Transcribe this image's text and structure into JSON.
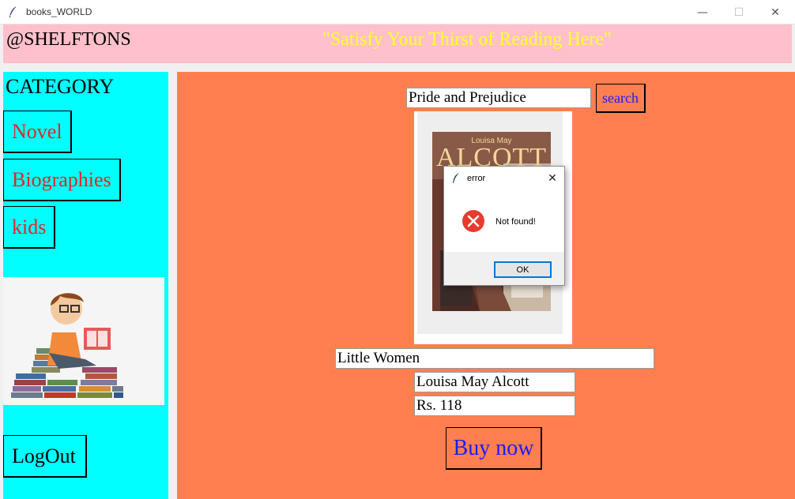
{
  "window": {
    "title": "books_WORLD",
    "controls": {
      "minimize": "—",
      "maximize": "☐",
      "close": "✕"
    }
  },
  "header": {
    "brand": "@SHELFTONS",
    "slogan": "\"Satisfy Your Thirst of Reading Here\""
  },
  "sidebar": {
    "category_title": "CATEGORY",
    "categories": [
      {
        "label": "Novel"
      },
      {
        "label": "Biographies"
      },
      {
        "label": "kids"
      }
    ],
    "logout_label": "LogOut"
  },
  "search": {
    "value": "Pride and Prejudice",
    "button_label": "search"
  },
  "book": {
    "cover_author_small": "Louisa May",
    "cover_author_big": "ALCOTT",
    "title": "Little Women",
    "author": "Louisa May Alcott",
    "price": "Rs. 118",
    "buy_label": "Buy now"
  },
  "dialog": {
    "title": "error",
    "message": "Not found!",
    "ok_label": "OK",
    "close_glyph": "✕"
  },
  "colors": {
    "header_bg": "#ffc0cb",
    "slogan": "#ffff33",
    "sidebar_bg": "#00ffff",
    "category_text": "#e0262b",
    "main_bg": "#ff7f50",
    "link_blue": "#1a1aff",
    "error_red": "#e53c2e"
  }
}
